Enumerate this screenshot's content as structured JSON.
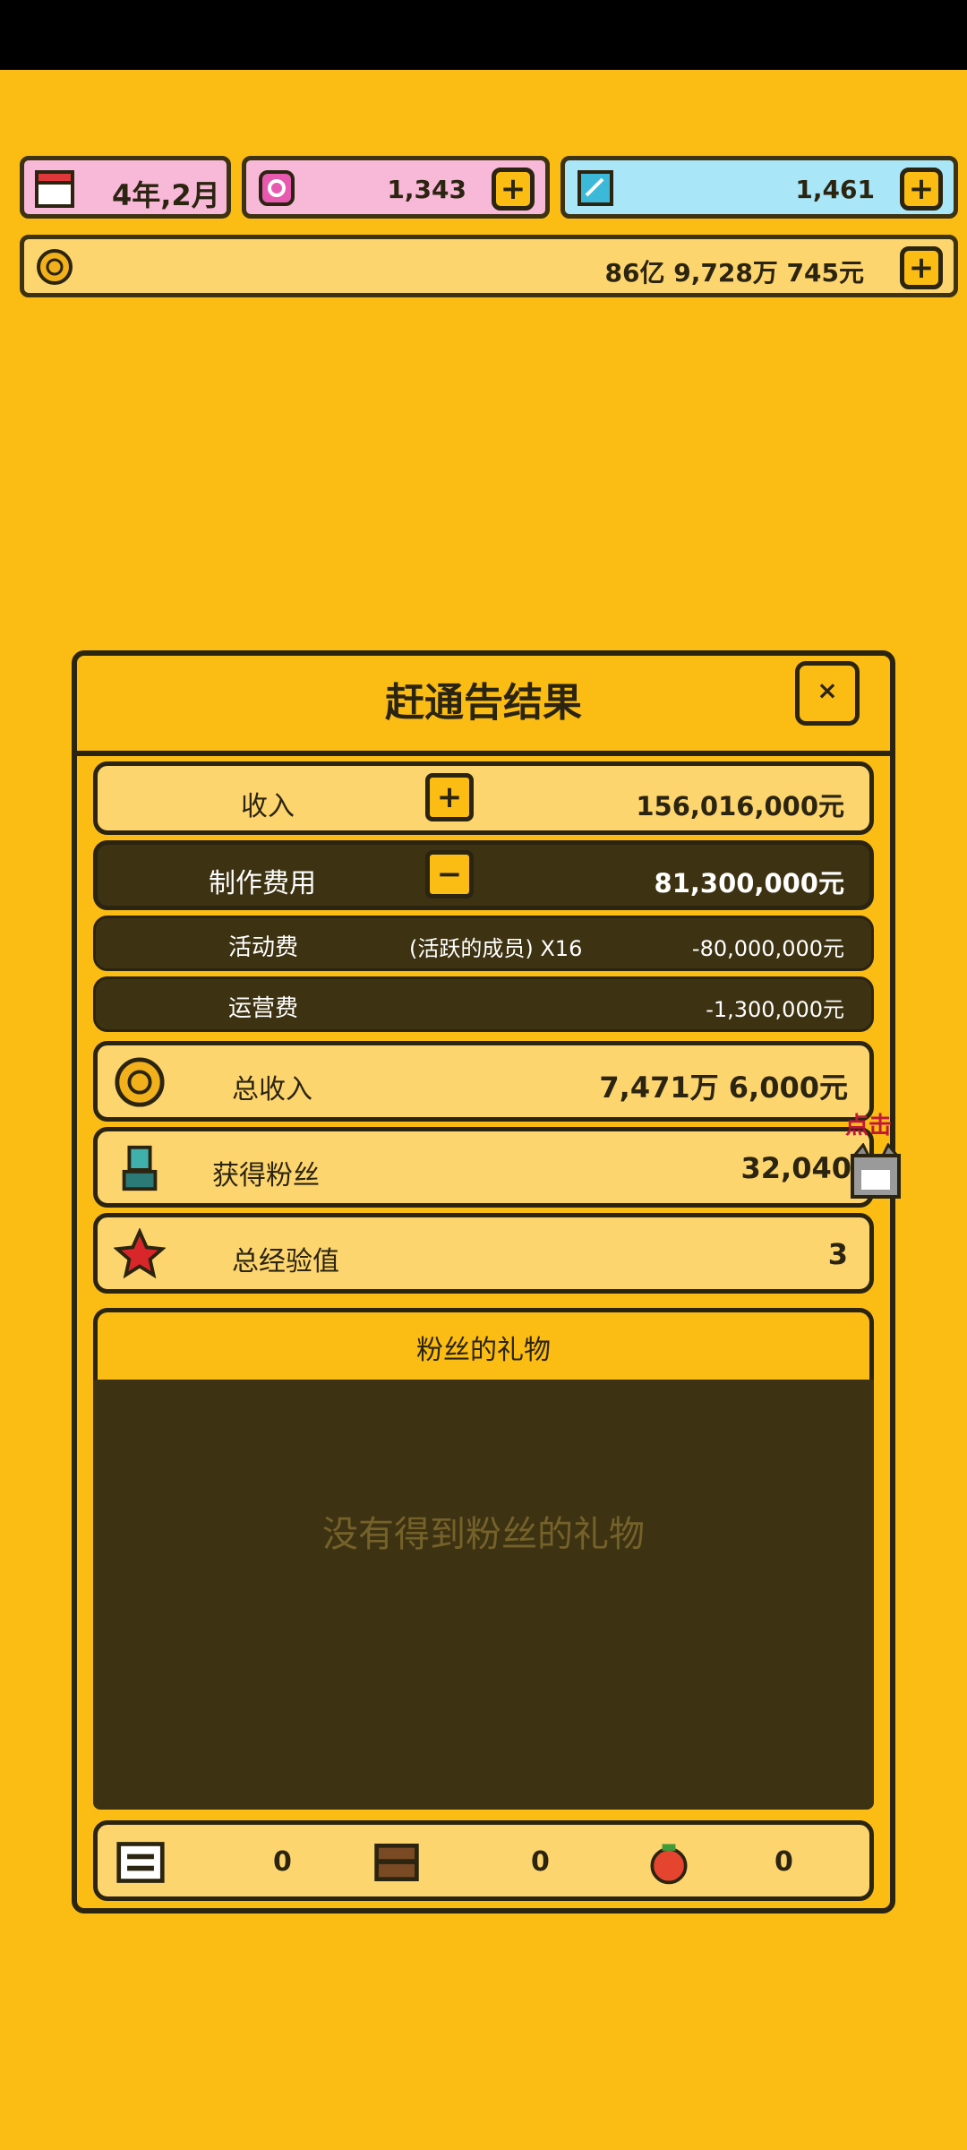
{
  "hud": {
    "date": "4年,2月",
    "pink_currency": "1,343",
    "blue_currency": "1,461",
    "money": "86亿 9,728万 745元",
    "icons": {
      "date": "calendar-icon",
      "pink": "pink-gem-icon",
      "blue": "blue-gem-icon",
      "money": "gold-coin-icon",
      "plus": "plus-icon"
    }
  },
  "panel": {
    "title": "赶通告结果",
    "close_label": "×",
    "income": {
      "label": "收入",
      "value": "156,016,000元",
      "sign": "+"
    },
    "cost": {
      "label": "制作费用",
      "value": "81,300,000元",
      "sign": "−"
    },
    "activity_fee": {
      "label": "活动费",
      "detail": "(活跃的成员) X16",
      "value": "-80,000,000元"
    },
    "operation_fee": {
      "label": "运营费",
      "value": "-1,300,000元"
    },
    "total_income": {
      "label": "总收入",
      "value": "7,471万 6,000元"
    },
    "fans": {
      "label": "获得粉丝",
      "value": "32,040"
    },
    "exp": {
      "label": "总经验值",
      "value": "3"
    },
    "gifts": {
      "title": "粉丝的礼物",
      "empty_text": "没有得到粉丝的礼物"
    },
    "bottom_items": [
      {
        "icon": "stage-icon",
        "count": "0"
      },
      {
        "icon": "treasure-chest-icon",
        "count": "0"
      },
      {
        "icon": "tomato-icon",
        "count": "0"
      }
    ]
  },
  "click_hint": "点击",
  "colors": {
    "background": "#FBBD14",
    "dark": "#3d3212",
    "light_row": "#FDD56F",
    "pink": "#F8B8D8",
    "blue": "#A8E6F8"
  }
}
